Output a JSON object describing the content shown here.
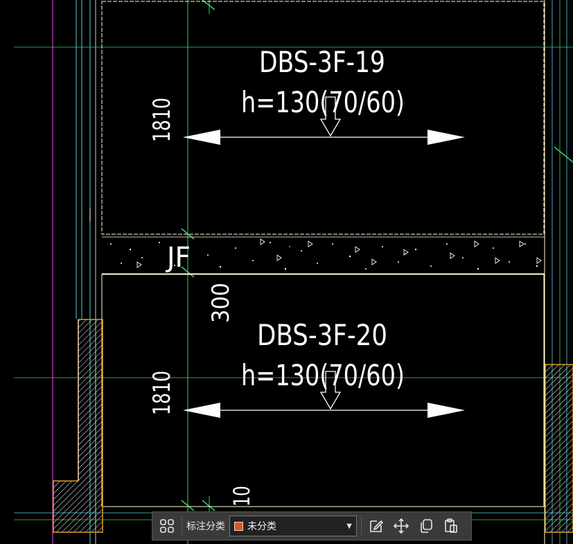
{
  "drawing": {
    "slab_top": {
      "id": "DBS-3F-19",
      "spec": "h=130(70/60)",
      "dim_span": "1810"
    },
    "slab_bottom": {
      "id": "DBS-3F-20",
      "spec": "h=130(70/60)",
      "dim_span": "1810"
    },
    "joint_label": "JF",
    "dim_gap": "300",
    "dim_small": "10"
  },
  "toolbar": {
    "label": "标注分类",
    "category_value": "未分类",
    "category_color": "#e8501a",
    "icons": [
      "grid-icon",
      "edit-icon",
      "move-icon",
      "copy-icon",
      "paste-icon"
    ]
  },
  "colors": {
    "background": "#000000",
    "slab_outline": "#ffffcc",
    "grid_line": "#3fd06a",
    "cyan_line": "#4fd2e0",
    "magenta_line": "#d63bd6",
    "hatch": "#e0a020"
  }
}
